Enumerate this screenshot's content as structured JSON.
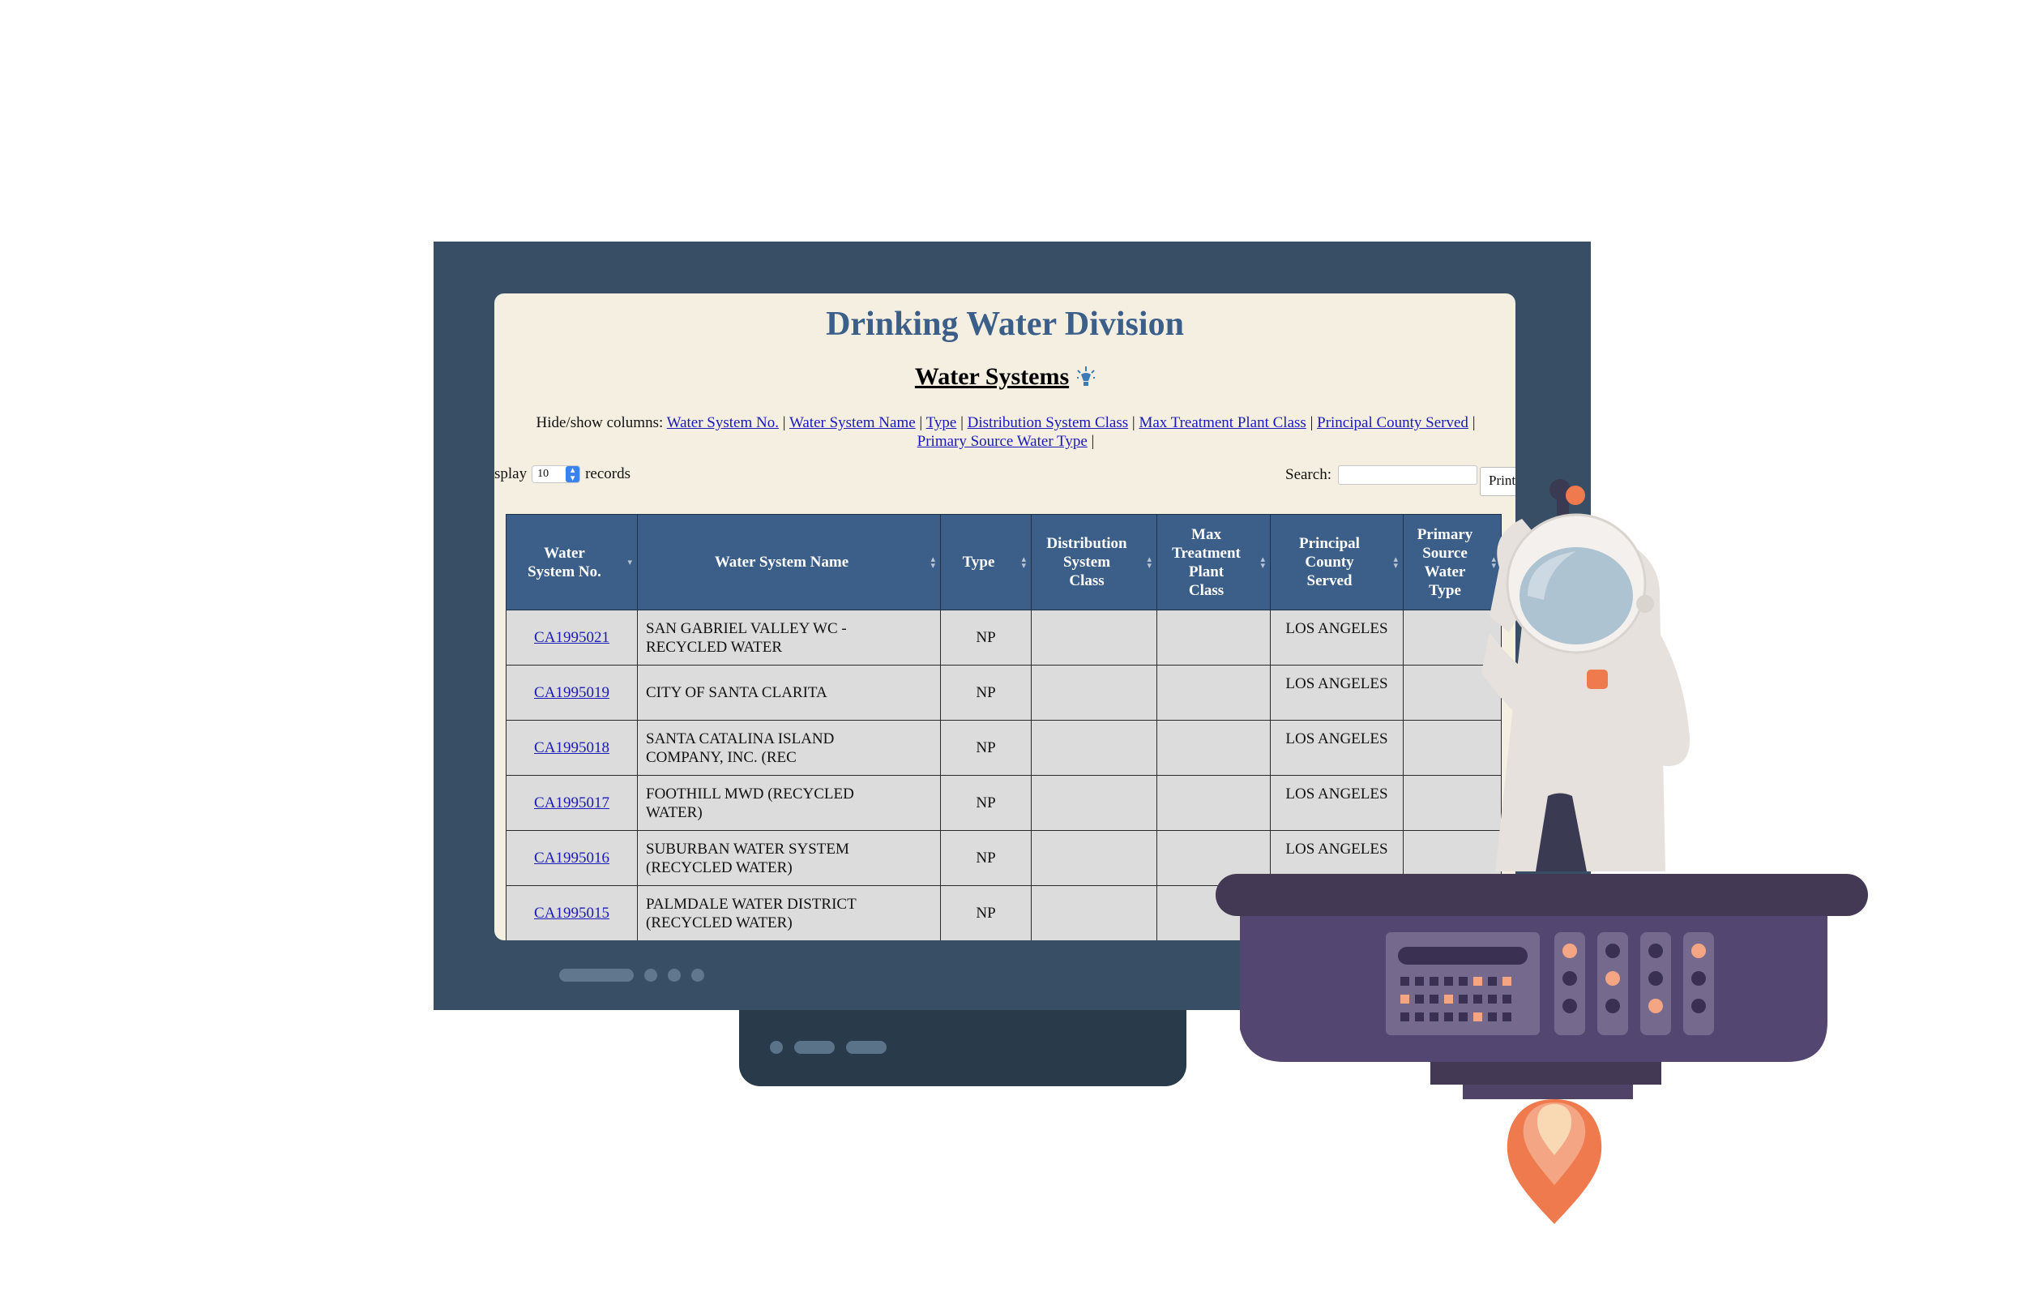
{
  "page": {
    "title": "Drinking Water Division",
    "subtitle": "Water Systems"
  },
  "hide_show": {
    "label": "Hide/show columns:",
    "links": [
      "Water System No.",
      "Water System Name",
      "Type",
      "Distribution System Class",
      "Max Treatment Plant Class",
      "Principal County Served",
      "Primary Source Water Type"
    ]
  },
  "controls": {
    "display_prefix": "splay",
    "display_value": "10",
    "display_suffix": "records",
    "search_label": "Search:",
    "search_value": "",
    "print_label": "Print"
  },
  "table": {
    "headers": [
      [
        "Water",
        "System No."
      ],
      [
        "Water System Name"
      ],
      [
        "Type"
      ],
      [
        "Distribution",
        "System",
        "Class"
      ],
      [
        "Max",
        "Treatment",
        "Plant",
        "Class"
      ],
      [
        "Principal",
        "County",
        "Served"
      ],
      [
        "Primary",
        "Source",
        "Water",
        "Type"
      ]
    ],
    "rows": [
      {
        "id": "CA1995021",
        "name": [
          "SAN GABRIEL VALLEY WC -",
          "RECYCLED WATER"
        ],
        "type": "NP",
        "dist": "",
        "max": "",
        "county": "LOS ANGELES",
        "source": ""
      },
      {
        "id": "CA1995019",
        "name": [
          "CITY OF SANTA CLARITA"
        ],
        "type": "NP",
        "dist": "",
        "max": "",
        "county": "LOS ANGELES",
        "source": ""
      },
      {
        "id": "CA1995018",
        "name": [
          "SANTA CATALINA ISLAND",
          "COMPANY, INC. (REC"
        ],
        "type": "NP",
        "dist": "",
        "max": "",
        "county": "LOS ANGELES",
        "source": ""
      },
      {
        "id": "CA1995017",
        "name": [
          "FOOTHILL MWD (RECYCLED",
          "WATER)"
        ],
        "type": "NP",
        "dist": "",
        "max": "",
        "county": "LOS ANGELES",
        "source": ""
      },
      {
        "id": "CA1995016",
        "name": [
          "SUBURBAN WATER SYSTEM",
          "(RECYCLED WATER)"
        ],
        "type": "NP",
        "dist": "",
        "max": "",
        "county": "LOS ANGELES",
        "source": ""
      },
      {
        "id": "CA1995015",
        "name": [
          "PALMDALE WATER DISTRICT",
          "(RECYCLED WATER)"
        ],
        "type": "NP",
        "dist": "",
        "max": "",
        "county": "",
        "source": ""
      }
    ]
  },
  "colors": {
    "monitor": "#374e65",
    "screen_bg": "#f5efe1",
    "header_bg": "#3c5f8a",
    "link": "#1a1ab8",
    "console": "#534670",
    "accent_orange": "#ef7a4d"
  }
}
